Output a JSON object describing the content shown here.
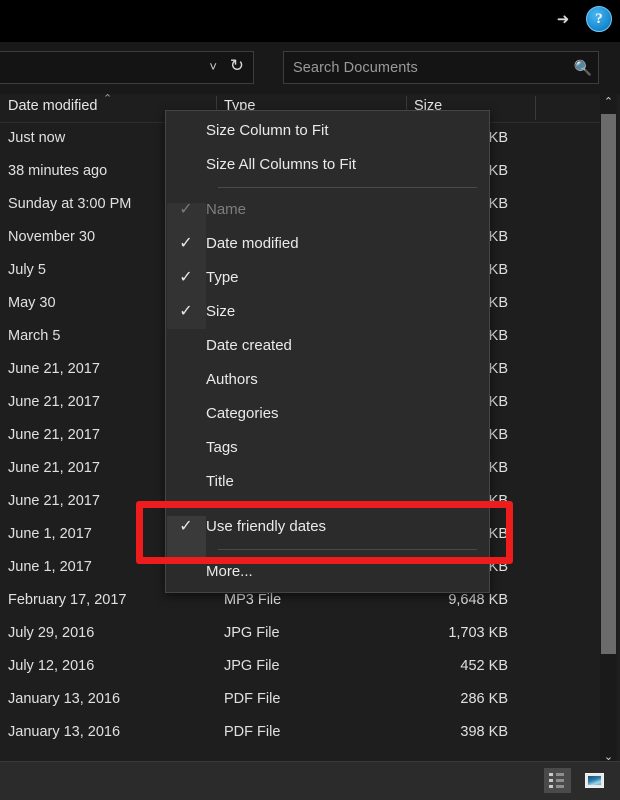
{
  "titlebar": {
    "ribbon_chevron_icon": "chevron-down-icon",
    "help_label": "?"
  },
  "navbar": {
    "address_chevron_icon": "chevron-down-icon",
    "refresh_icon": "refresh-icon",
    "search_placeholder": "Search Documents",
    "search_value": "",
    "search_icon": "search-icon"
  },
  "columns": {
    "date_modified": "Date modified",
    "type": "Type",
    "size": "Size",
    "sort_chevron_icon": "chevron-up-icon"
  },
  "rows": [
    {
      "date": "Just now",
      "type": "",
      "size": "KB"
    },
    {
      "date": "38 minutes ago",
      "type": "",
      "size": "KB"
    },
    {
      "date": "Sunday at 3:00 PM",
      "type": "",
      "size": "KB"
    },
    {
      "date": "November 30",
      "type": "",
      "size": "KB"
    },
    {
      "date": "July 5",
      "type": "",
      "size": "KB"
    },
    {
      "date": "May 30",
      "type": "",
      "size": "KB"
    },
    {
      "date": "March 5",
      "type": "",
      "size": "KB"
    },
    {
      "date": "June 21, 2017",
      "type": "",
      "size": "KB"
    },
    {
      "date": "June 21, 2017",
      "type": "",
      "size": "KB"
    },
    {
      "date": "June 21, 2017",
      "type": "",
      "size": "KB"
    },
    {
      "date": "June 21, 2017",
      "type": "",
      "size": "KB"
    },
    {
      "date": "June 21, 2017",
      "type": "",
      "size": "KB"
    },
    {
      "date": "June 1, 2017",
      "type": "",
      "size": "KB"
    },
    {
      "date": "June 1, 2017",
      "type": "",
      "size": "KB"
    },
    {
      "date": "February 17, 2017",
      "type": "MP3 File",
      "size": "9,648 KB"
    },
    {
      "date": "July 29, 2016",
      "type": "JPG File",
      "size": "1,703 KB"
    },
    {
      "date": "July 12, 2016",
      "type": "JPG File",
      "size": "452 KB"
    },
    {
      "date": "January 13, 2016",
      "type": "PDF File",
      "size": "286 KB"
    },
    {
      "date": "January 13, 2016",
      "type": "PDF File",
      "size": "398 KB"
    }
  ],
  "context_menu": {
    "items": [
      {
        "label": "Size Column to Fit",
        "checked": false,
        "disabled": false,
        "separator_after": false
      },
      {
        "label": "Size All Columns to Fit",
        "checked": false,
        "disabled": false,
        "separator_after": true
      },
      {
        "label": "Name",
        "checked": true,
        "disabled": true,
        "separator_after": false
      },
      {
        "label": "Date modified",
        "checked": true,
        "disabled": false,
        "separator_after": false
      },
      {
        "label": "Type",
        "checked": true,
        "disabled": false,
        "separator_after": false
      },
      {
        "label": "Size",
        "checked": true,
        "disabled": false,
        "separator_after": false
      },
      {
        "label": "Date created",
        "checked": false,
        "disabled": false,
        "separator_after": false
      },
      {
        "label": "Authors",
        "checked": false,
        "disabled": false,
        "separator_after": false
      },
      {
        "label": "Categories",
        "checked": false,
        "disabled": false,
        "separator_after": false
      },
      {
        "label": "Tags",
        "checked": false,
        "disabled": false,
        "separator_after": false
      },
      {
        "label": "Title",
        "checked": false,
        "disabled": false,
        "separator_after": true
      },
      {
        "label": "Use friendly dates",
        "checked": true,
        "disabled": false,
        "separator_after": true
      },
      {
        "label": "More...",
        "checked": false,
        "disabled": false,
        "separator_after": false
      }
    ],
    "check_glyph": "✓"
  },
  "scrollbar": {
    "up_arrow_icon": "chevron-up-icon",
    "down_arrow_icon": "chevron-down-icon"
  },
  "statusbar": {
    "details_view_icon": "details-view-icon",
    "thumbnail_view_icon": "large-icons-view-icon"
  },
  "annotation": {
    "highlight_color": "#ee1c1c",
    "target_label": "Use friendly dates"
  }
}
